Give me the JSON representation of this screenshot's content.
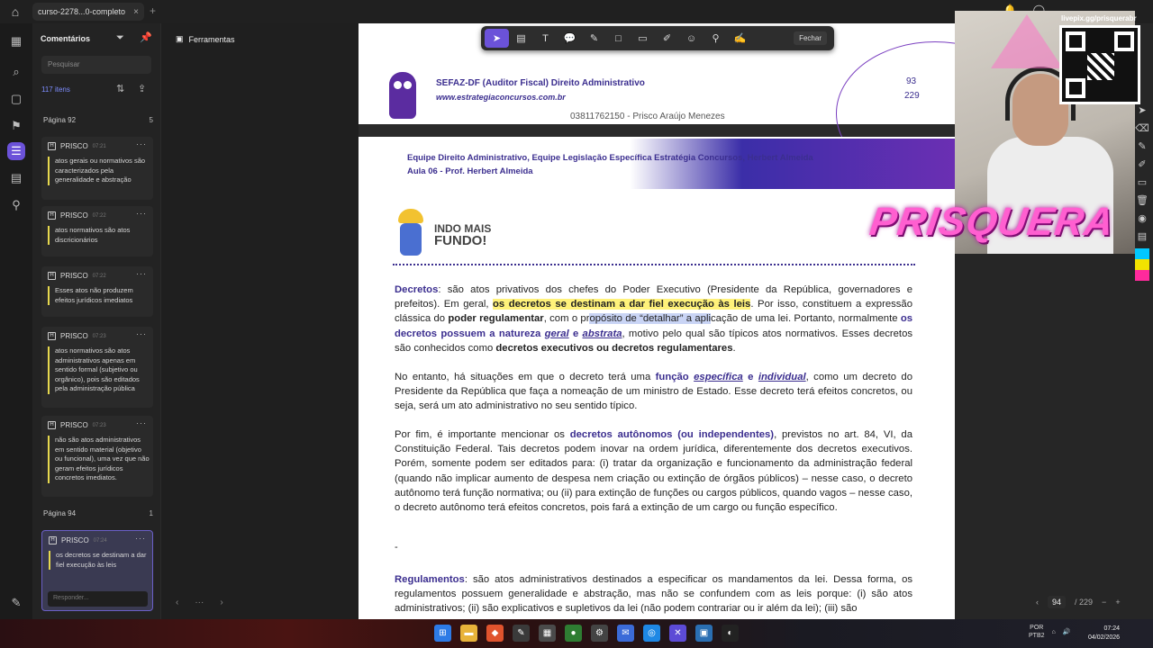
{
  "titlebar": {
    "tab_title": "curso-2278...0-completo",
    "tab_close": "×",
    "new_tab": "+"
  },
  "comments_panel": {
    "title": "Comentários",
    "search_placeholder": "Pesquisar",
    "count": "117 itens",
    "groups": [
      {
        "page": "Página 92",
        "count": "5"
      },
      {
        "page": "Página 94",
        "count": "1"
      }
    ],
    "cards": [
      {
        "author": "PRISCO",
        "time": "07:21",
        "text": "atos gerais ou normativos são caracterizados pela generalidade e abstração"
      },
      {
        "author": "PRISCO",
        "time": "07:22",
        "text": "atos normativos são atos discricionários"
      },
      {
        "author": "PRISCO",
        "time": "07:22",
        "text": "Esses atos não produzem efeitos jurídicos imediatos"
      },
      {
        "author": "PRISCO",
        "time": "07:23",
        "text": "atos normativos são atos administrativos apenas em sentido formal (subjetivo ou orgânico), pois são editados pela administração pública"
      },
      {
        "author": "PRISCO",
        "time": "07:23",
        "text": "não são atos administrativos em sentido material (objetivo ou funcional), uma vez que não geram efeitos jurídicos concretos imediatos."
      },
      {
        "author": "PRISCO",
        "time": "07:24",
        "text": "os decretos se destinam a dar fiel execução às leis"
      }
    ],
    "reply_placeholder": "Responder..."
  },
  "tools_panel": {
    "title": "Ferramentas"
  },
  "toolbar": {
    "close_label": "Fechar"
  },
  "page93": {
    "title": "SEFAZ-DF (Auditor Fiscal) Direito Administrativo",
    "url": "www.estrategiaconcursos.com.br",
    "owner": "03811762150 - Prisco Araújo Menezes",
    "page_number": "93",
    "page_total": "229"
  },
  "page94": {
    "team": "Equipe Direito Administrativo, Equipe Legislação Específica Estratégia Concursos, Herbert Almeida",
    "aula": "Aula 06 - Prof. Herbert Almeida",
    "badge_line1": "INDO MAIS",
    "badge_line2": "FUNDO!",
    "dash": "-"
  },
  "viewer_nav": {
    "current_page": "94",
    "total_pages": "/ 229"
  },
  "overlay": {
    "channel_url": "livepix.gg/prisquerabr",
    "brand": "PRISQUERA"
  },
  "taskbar": {
    "lang1": "POR",
    "lang2": "PTB2",
    "time": "07:24",
    "date": "04/02/2026"
  },
  "colors": {
    "accent": "#6b52d9",
    "doc_blue": "#3b2e8f",
    "highlight": "#fff27a"
  }
}
